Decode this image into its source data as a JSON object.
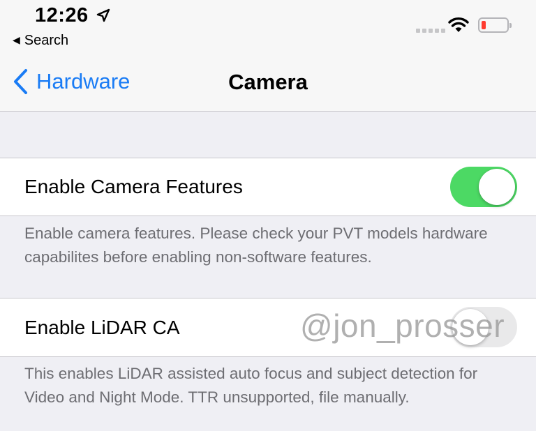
{
  "status_bar": {
    "time": "12:26",
    "location_icon": "location-arrow-icon",
    "back_app": "Search",
    "wifi_icon": "wifi-icon",
    "battery_icon": "battery-low-icon",
    "battery_color": "#ff3b30"
  },
  "nav": {
    "back_label": "Hardware",
    "title": "Camera",
    "accent_color": "#1a7cf5"
  },
  "sections": [
    {
      "label": "Enable Camera Features",
      "toggle_on": true,
      "footer": "Enable camera features. Please check your PVT models hardware capabilites before enabling non-software features."
    },
    {
      "label": "Enable LiDAR CA",
      "toggle_on": false,
      "footer": "This enables LiDAR assisted auto focus and subject detection for Video and Night Mode. TTR unsupported, file manually."
    }
  ],
  "toggle_on_color": "#4cd964",
  "watermark": "@jon_prosser"
}
